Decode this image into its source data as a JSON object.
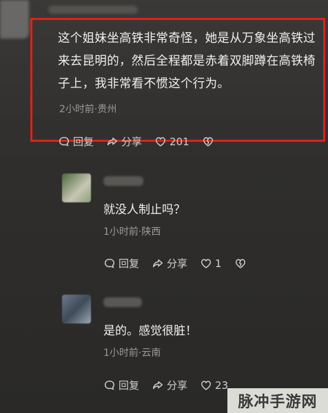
{
  "comment": {
    "text": "这个姐妹坐高铁非常奇怪，她是从万象坐高铁过来去昆明的，然后全程都是赤着双脚蹲在高铁椅子上，我非常看不惯这个行为。",
    "meta": "2小时前·贵州",
    "reply_label": "回复",
    "share_label": "分享",
    "like_count": "201"
  },
  "replies": [
    {
      "text": "就没人制止吗？",
      "meta": "1小时前·陕西",
      "reply_label": "回复",
      "share_label": "分享",
      "like_count": "1"
    },
    {
      "text": "是的。感觉很脏！",
      "meta": "1小时前·云南",
      "reply_label": "回复",
      "share_label": "分享",
      "like_count": "23"
    }
  ],
  "watermark": "脉冲手游网",
  "colors": {
    "highlight_border": "#e0201a",
    "background": "#2f2e2c",
    "meta_text": "#9c9a97"
  },
  "icons": [
    "comment-icon",
    "share-icon",
    "heart-icon",
    "broken-heart-icon"
  ]
}
